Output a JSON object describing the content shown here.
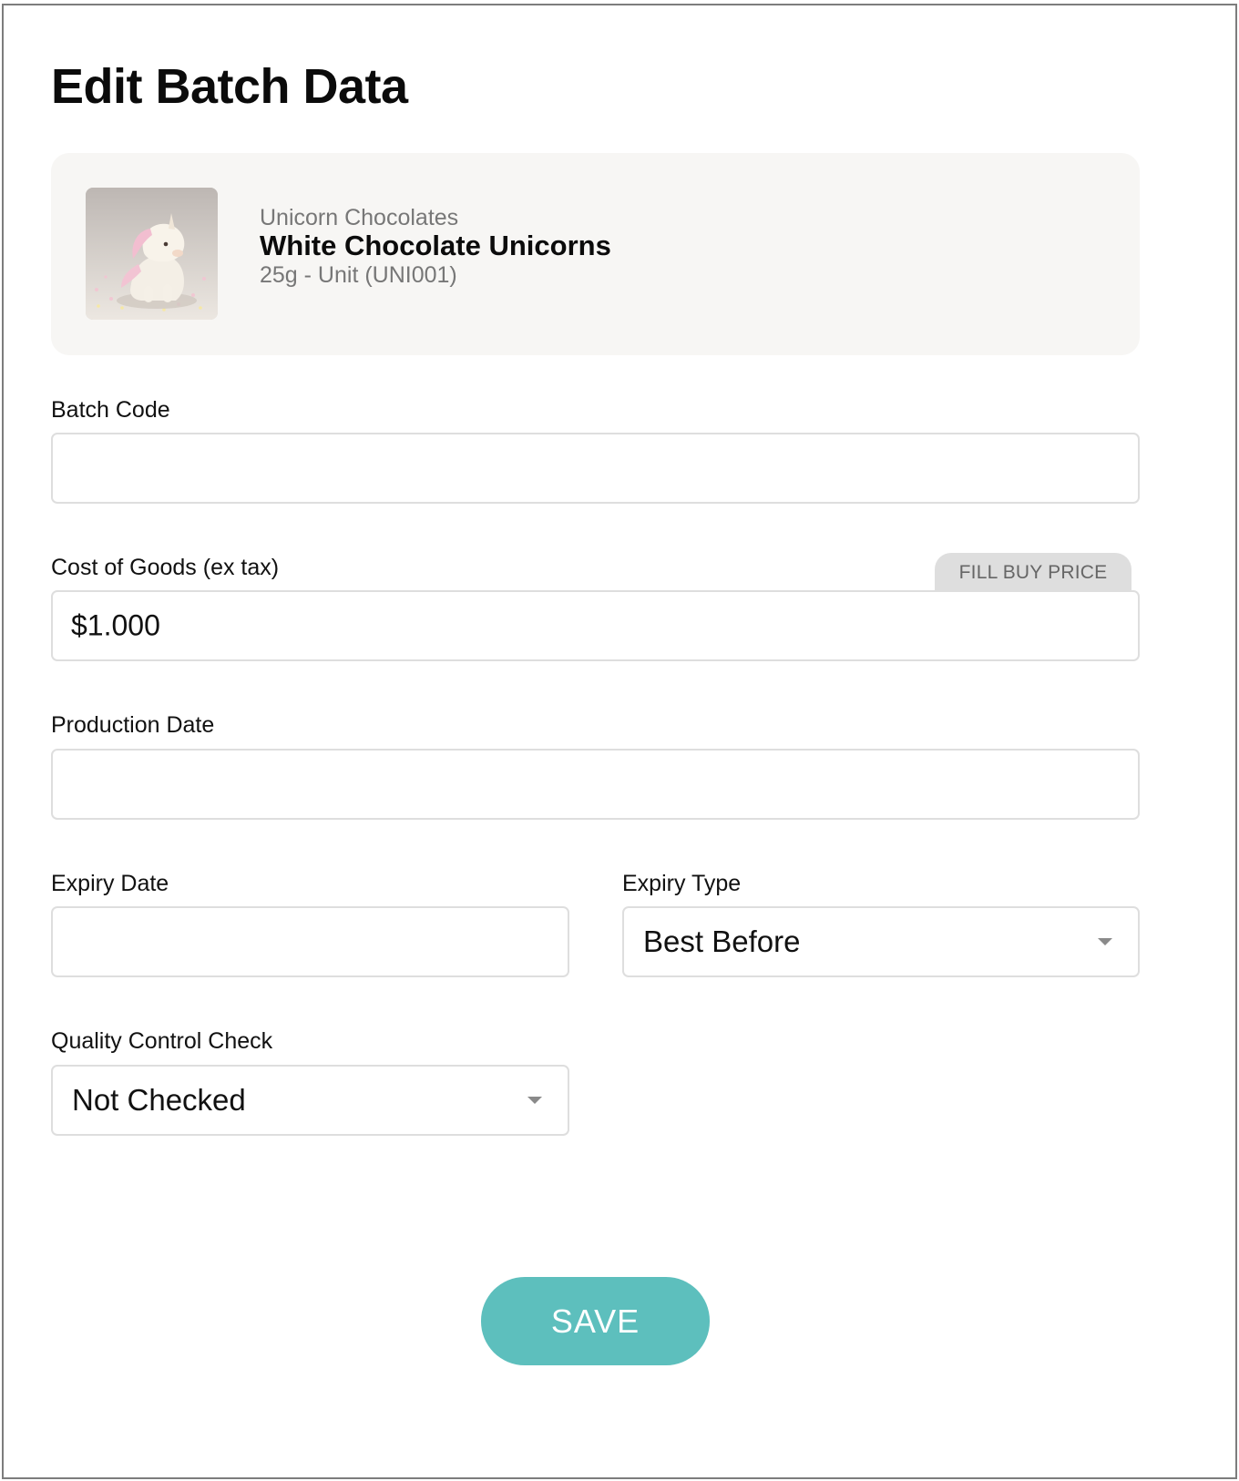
{
  "page": {
    "title": "Edit Batch Data"
  },
  "product": {
    "brand": "Unicorn Chocolates",
    "name": "White Chocolate Unicorns",
    "variant": "25g - Unit (UNI001)",
    "image_alt": "White chocolate unicorn figure"
  },
  "form": {
    "batch_code": {
      "label": "Batch Code",
      "value": ""
    },
    "cost_of_goods": {
      "label": "Cost of Goods (ex tax)",
      "value": "$1.000",
      "fill_button": "FILL BUY PRICE"
    },
    "production_date": {
      "label": "Production Date",
      "value": ""
    },
    "expiry_date": {
      "label": "Expiry Date",
      "value": ""
    },
    "expiry_type": {
      "label": "Expiry Type",
      "value": "Best Before"
    },
    "quality_control": {
      "label": "Quality Control Check",
      "value": "Not Checked"
    }
  },
  "actions": {
    "save_label": "SAVE"
  },
  "colors": {
    "accent": "#5dbfbd",
    "card_background": "#f7f6f4",
    "border": "#dedede"
  },
  "icons": {
    "dropdown": "chevron-down-icon"
  }
}
